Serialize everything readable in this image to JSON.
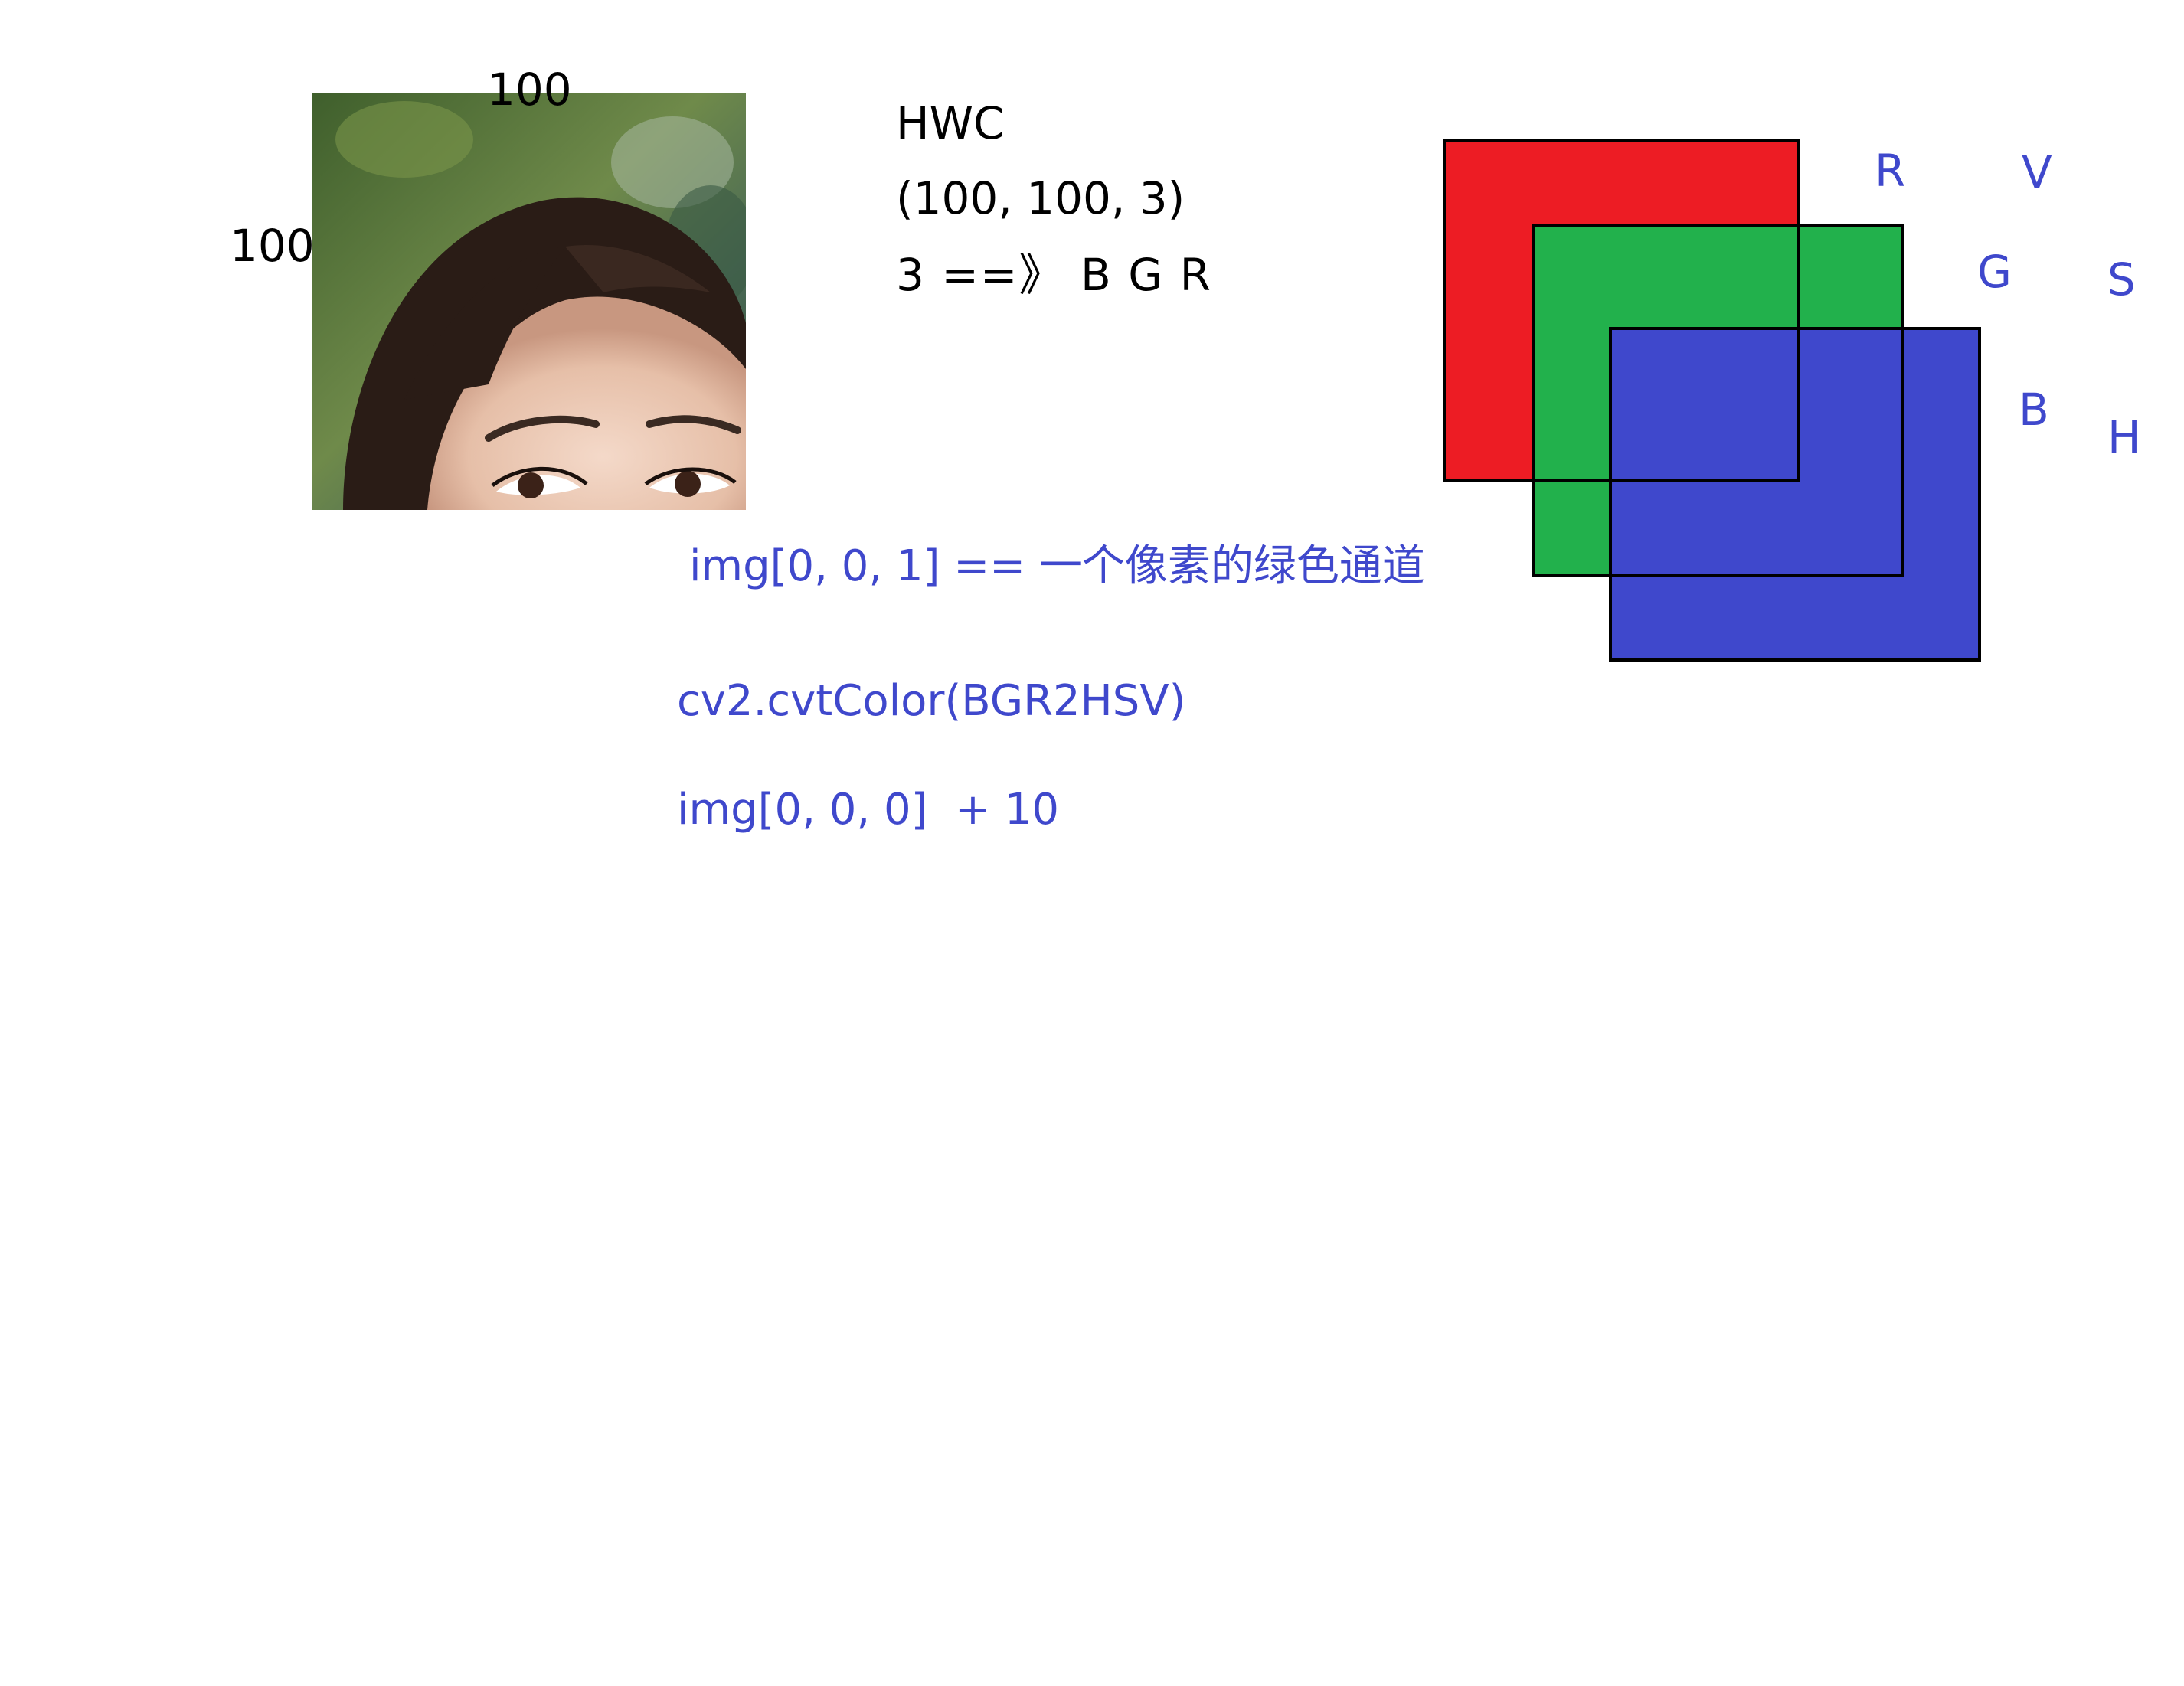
{
  "image_labels": {
    "width": "100",
    "height": "100"
  },
  "shape_info": {
    "layout": "HWC",
    "shape": "(100, 100, 3)",
    "channels": "3 ==》 B G R"
  },
  "code_lines": {
    "index": "img[0, 0, 1] == 一个像素的绿色通道",
    "convert": "cv2.cvtColor(BGR2HSV)",
    "add": "img[0, 0, 0]  + 10"
  },
  "rgb_labels": {
    "r": "R",
    "g": "G",
    "b": "B"
  },
  "hsv_labels": {
    "v": "V",
    "s": "S",
    "h": "H"
  },
  "colors": {
    "red_layer": "#ed1c24",
    "green_layer": "#22b14c",
    "blue_layer": "#3f48cc",
    "text_blue": "#3f48cc"
  },
  "photo": {
    "icon": "portrait-photo"
  }
}
